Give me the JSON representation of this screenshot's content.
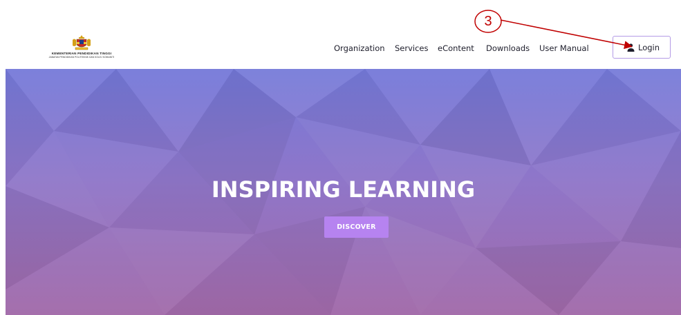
{
  "header": {
    "logo": {
      "line1": "KEMENTERIAN PENDIDIKAN TINGGI",
      "line2": "JABATAN PENDIDIKAN POLITEKNIK DAN KOLEJ KOMUNITI"
    },
    "nav": [
      {
        "label": "Organization"
      },
      {
        "label": "Services"
      },
      {
        "label": "eContent"
      },
      {
        "label": "Downloads"
      },
      {
        "label": "User Manual"
      }
    ],
    "login_label": "Login"
  },
  "hero": {
    "title": "INSPIRING LEARNING",
    "button_label": "DISCOVER"
  },
  "annotation": {
    "number": "3",
    "color": "#c00000"
  },
  "colors": {
    "accent": "#b683f0",
    "login_border": "#b39ae6",
    "hero_top": "#7479d9",
    "hero_bottom": "#a26aa9"
  }
}
